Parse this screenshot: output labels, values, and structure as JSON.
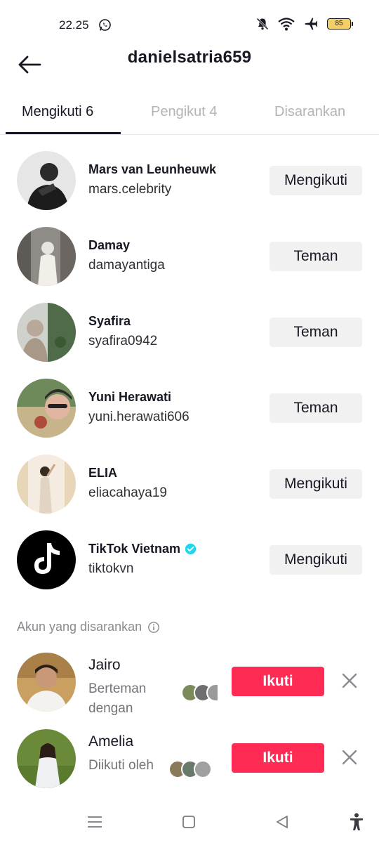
{
  "status_bar": {
    "time": "22.25",
    "battery": "85"
  },
  "header": {
    "title": "danielsatria659"
  },
  "tabs": [
    {
      "label": "Mengikuti 6",
      "active": true
    },
    {
      "label": "Pengikut 4",
      "active": false
    },
    {
      "label": "Disarankan",
      "active": false
    }
  ],
  "following": [
    {
      "name": "Mars van Leunheuwk",
      "handle": "mars.celebrity",
      "button": "Mengikuti",
      "verified": false
    },
    {
      "name": "Damay",
      "handle": "damayantiga",
      "button": "Teman",
      "verified": false
    },
    {
      "name": "Syafira",
      "handle": "syafira0942",
      "button": "Teman",
      "verified": false
    },
    {
      "name": "Yuni Herawati",
      "handle": "yuni.herawati606",
      "button": "Teman",
      "verified": false
    },
    {
      "name": "ELIA",
      "handle": "eliacahaya19",
      "button": "Mengikuti",
      "verified": false
    },
    {
      "name": "TikTok Vietnam",
      "handle": "tiktokvn",
      "button": "Mengikuti",
      "verified": true
    }
  ],
  "suggested": {
    "header": "Akun yang disarankan",
    "accounts": [
      {
        "name": "Jairo",
        "subtitle": "Berteman dengan",
        "button": "Ikuti"
      },
      {
        "name": "Amelia",
        "subtitle": "Diikuti oleh",
        "button": "Ikuti"
      }
    ]
  },
  "colors": {
    "accent": "#fe2c55",
    "verified": "#20d5ec",
    "secondary_button": "#f1f1f2"
  },
  "icons": {
    "back": "arrow-left-icon",
    "info": "info-icon",
    "dismiss": "close-icon",
    "nav": [
      "menu-icon",
      "home-square-icon",
      "back-triangle-icon",
      "accessibility-icon"
    ]
  }
}
